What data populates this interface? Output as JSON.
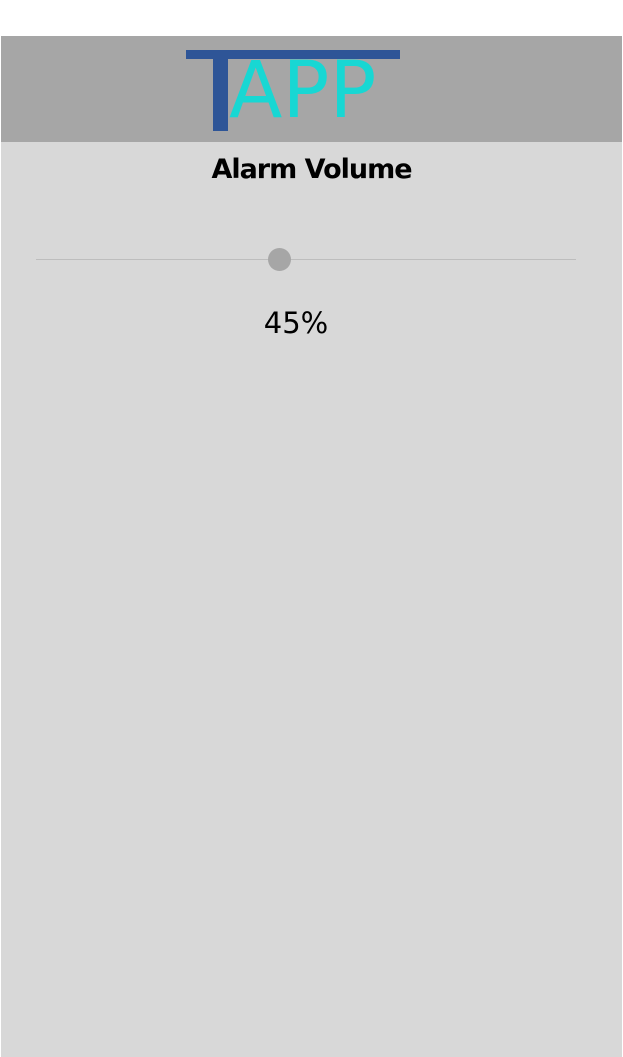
{
  "app": {
    "logo_text": "TAPP",
    "logo_visible_text": "APP",
    "logo_colors": {
      "t_bar": "#2e5597",
      "letters": "#18d7d3"
    }
  },
  "header": {
    "background": "#a6a6a6"
  },
  "screen": {
    "title": "Alarm Volume",
    "background": "#d8d8d8"
  },
  "volume_slider": {
    "value_percent": 45,
    "value_label": "45%",
    "min": 0,
    "max": 100,
    "thumb_color": "#a6a6a6"
  }
}
